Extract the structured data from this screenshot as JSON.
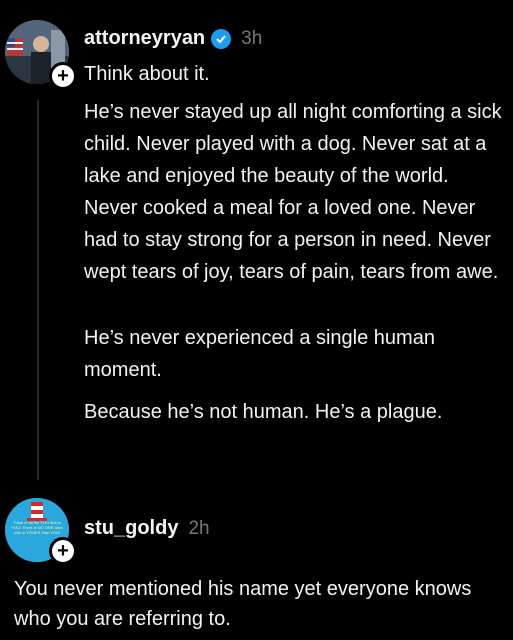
{
  "post": {
    "username": "attorneyryan",
    "time": "3h",
    "title": "Think about it.",
    "paragraphs": [
      "He’s never stayed up all night comforting a sick child. Never played with a dog. Never sat at a lake and enjoyed the beauty of the world. Never cooked a meal for a loved one. Never had to stay strong for a person in need. Never wept tears of joy, tears of pain, tears from awe.",
      "He’s never experienced a single human moment.",
      "Because he’s not human. He’s a plague."
    ]
  },
  "reply": {
    "username": "stu_goldy",
    "time": "2h",
    "text": "You never mentioned his name yet everyone knows who you are referring to.",
    "avatar_text": "Think of all the YOU that is YOU! There is NO ONE alive who is YOUER than YOU!"
  },
  "colors": {
    "background": "#000000",
    "verified": "#1d9bf0",
    "muted": "#777777"
  }
}
